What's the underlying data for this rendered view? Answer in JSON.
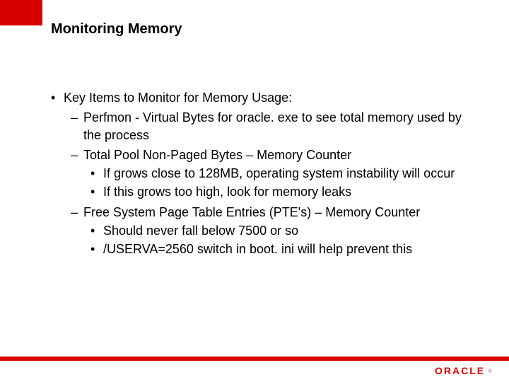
{
  "title": "Monitoring Memory",
  "heading": "Key Items to Monitor for Memory Usage:",
  "items": [
    {
      "text": "Perfmon - Virtual Bytes for oracle. exe to see total memory used by the process",
      "sub": []
    },
    {
      "text": "Total Pool Non-Paged Bytes – Memory Counter",
      "sub": [
        "If grows close to 128MB, operating system instability will occur",
        "If this grows too high, look for memory leaks"
      ]
    },
    {
      "text": "Free System Page Table Entries (PTE's) – Memory Counter",
      "sub": [
        "Should never fall below 7500 or so",
        "/USERVA=2560 switch in boot. ini will help prevent this"
      ]
    }
  ],
  "logo_text": "ORACLE"
}
